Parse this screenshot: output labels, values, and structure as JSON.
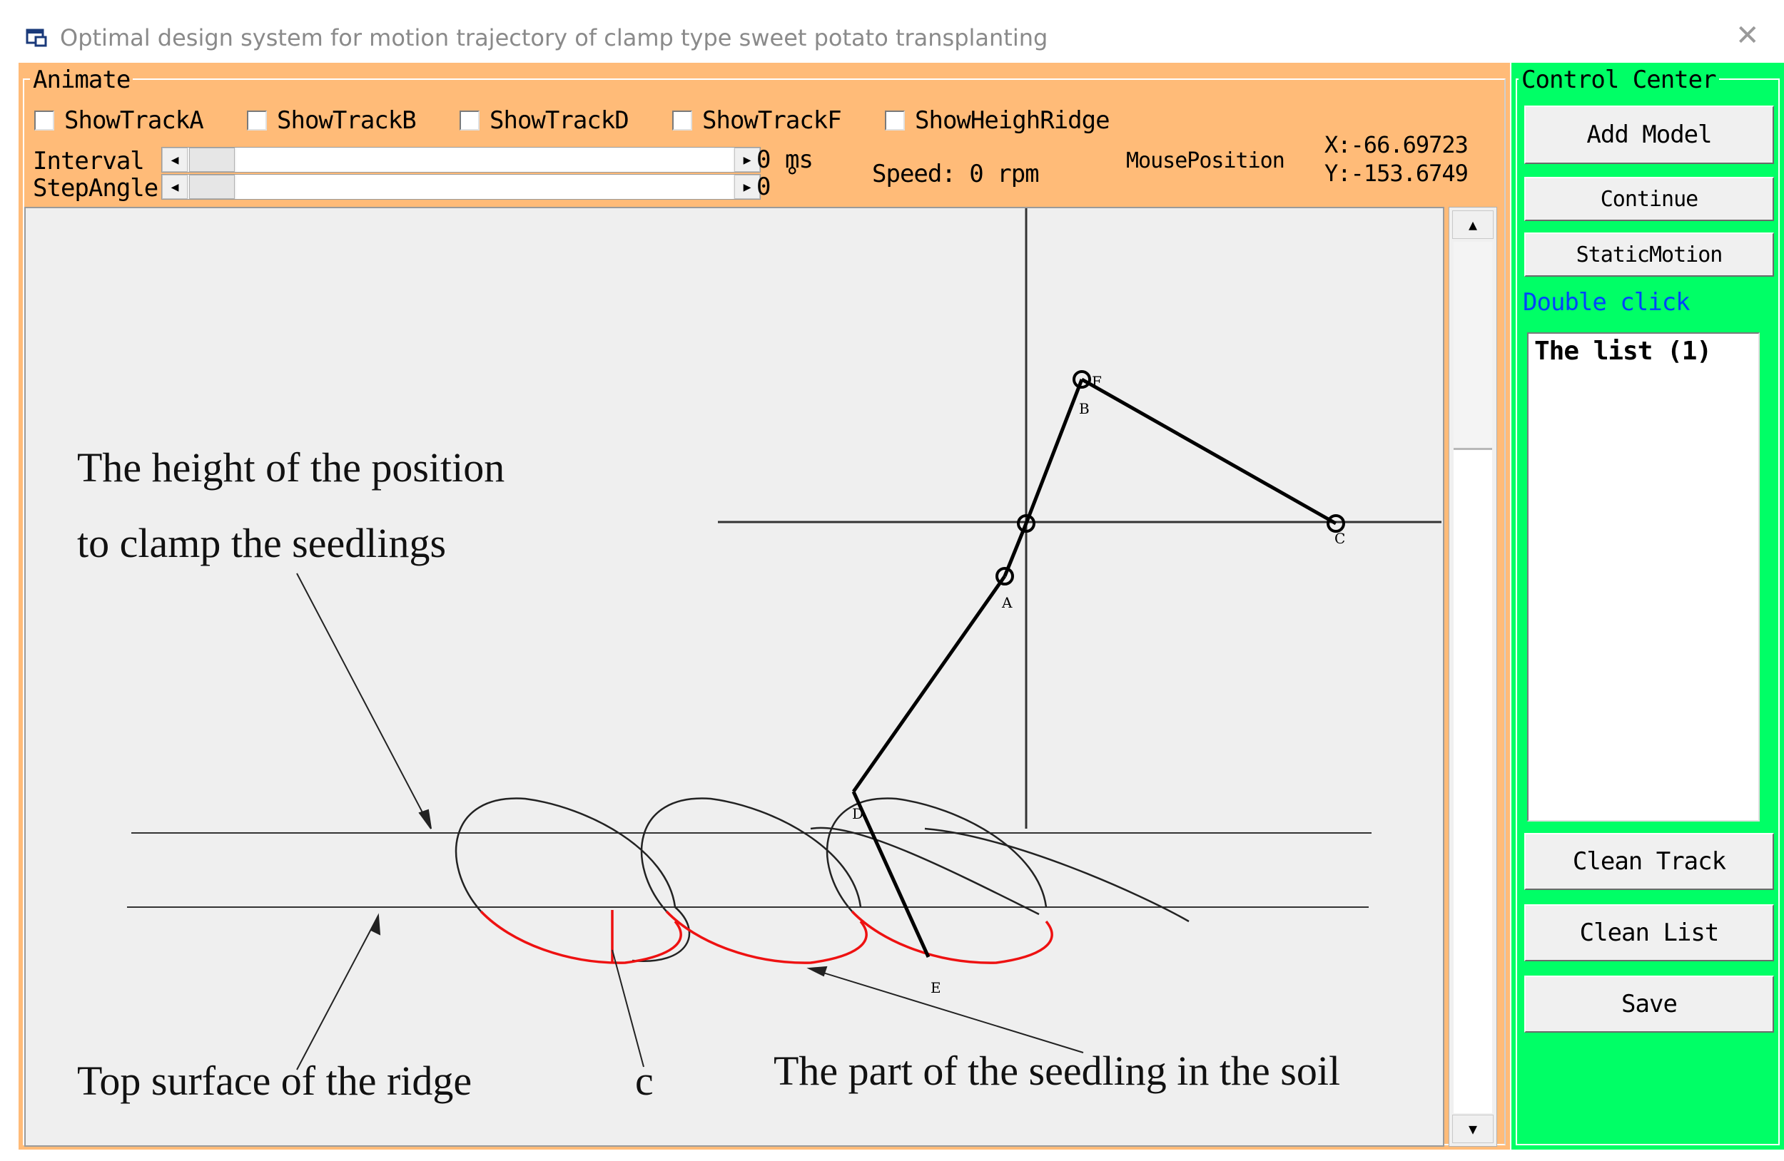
{
  "window": {
    "title": "Optimal design system for motion trajectory of clamp type sweet potato transplanting",
    "icon": "app-window-icon",
    "close_icon": "close-icon"
  },
  "animate": {
    "group_label": "Animate",
    "checkboxes": [
      {
        "label": "ShowTrackA",
        "checked": false
      },
      {
        "label": "ShowTrackB",
        "checked": false
      },
      {
        "label": "ShowTrackD",
        "checked": false
      },
      {
        "label": "ShowTrackF",
        "checked": false
      },
      {
        "label": "ShowHeighRidge",
        "checked": false
      }
    ],
    "interval_label": "Interval",
    "interval_value": "0",
    "interval_unit": "ms",
    "stepangle_label": "StepAngle",
    "stepangle_value": "0",
    "stepangle_unit": "°",
    "speed_text": "Speed: 0 rpm",
    "mouse_position_label": "MousePosition",
    "mouse_x": "X:-66.69723",
    "mouse_y": "Y:-153.6749"
  },
  "canvas": {
    "annotation_height": [
      "The height of the position",
      "to clamp the seedlings"
    ],
    "annotation_ridge": "Top surface of the ridge",
    "annotation_c": "c",
    "annotation_soil": "The part of the seedling in the soil",
    "point_labels": {
      "A": "A",
      "B": "B",
      "C": "C",
      "D": "D",
      "E": "E",
      "F": "F"
    },
    "colors": {
      "soil_curve": "#ee1111",
      "trajectory": "#222222",
      "linkage": "#000000"
    }
  },
  "control": {
    "group_label": "Control Center",
    "add_model": "Add Model",
    "continue": "Continue",
    "static_motion": "StaticMotion",
    "double_click": "Double click",
    "list_items": [
      "The list (1)"
    ],
    "clean_track": "Clean Track",
    "clean_list": "Clean List",
    "save": "Save"
  }
}
